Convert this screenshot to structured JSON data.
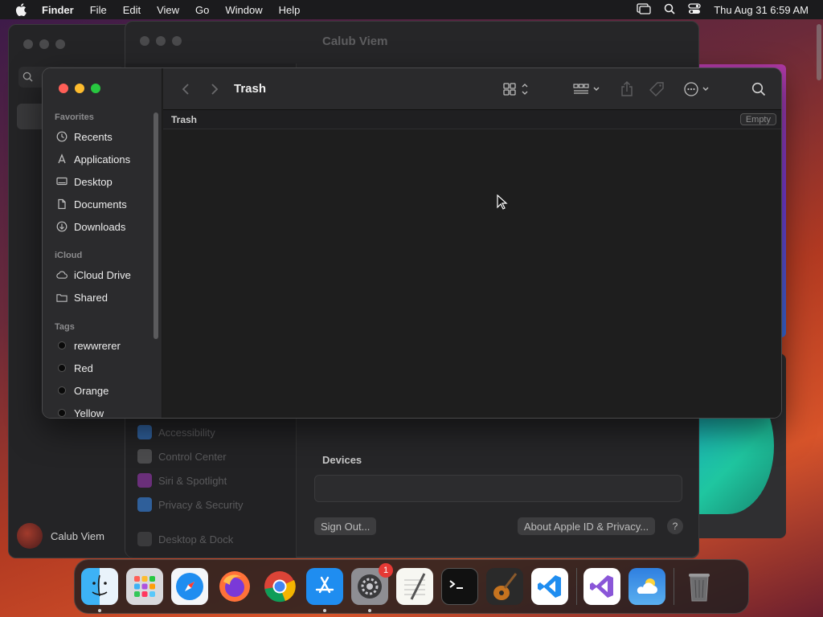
{
  "menubar": {
    "app_name": "Finder",
    "items": [
      "File",
      "Edit",
      "View",
      "Go",
      "Window",
      "Help"
    ],
    "clock": "Thu Aug 31  6:59 AM"
  },
  "background_window": {
    "title": "Calub Viem",
    "user_name": "Calub Viem",
    "sidebar_items": [
      "Accessibility",
      "Control Center",
      "Siri & Spotlight",
      "Privacy & Security",
      "Desktop & Dock"
    ],
    "devices_label": "Devices",
    "sign_out_label": "Sign Out...",
    "about_label": "About Apple ID & Privacy...",
    "help_label": "?"
  },
  "finder": {
    "title": "Trash",
    "path_label": "Trash",
    "empty_label": "Empty",
    "sidebar": {
      "favorites_header": "Favorites",
      "favorites": [
        {
          "label": "Recents",
          "icon": "clock-icon"
        },
        {
          "label": "Applications",
          "icon": "applications-icon"
        },
        {
          "label": "Desktop",
          "icon": "desktop-icon"
        },
        {
          "label": "Documents",
          "icon": "document-icon"
        },
        {
          "label": "Downloads",
          "icon": "download-icon"
        }
      ],
      "icloud_header": "iCloud",
      "icloud": [
        {
          "label": "iCloud Drive",
          "icon": "cloud-icon"
        },
        {
          "label": "Shared",
          "icon": "shared-folder-icon"
        }
      ],
      "tags_header": "Tags",
      "tags": [
        {
          "label": "rewwrerer"
        },
        {
          "label": "Red"
        },
        {
          "label": "Orange"
        },
        {
          "label": "Yellow"
        }
      ]
    }
  },
  "dock": {
    "apps": [
      "Finder",
      "Launchpad",
      "Safari",
      "Firefox",
      "Chrome",
      "App Store",
      "System Settings",
      "TextEdit",
      "Terminal",
      "GarageBand",
      "VS Code",
      "Visual Studio",
      "Weather",
      "Trash"
    ],
    "settings_badge": "1"
  },
  "colors": {
    "red": "#ff5f57",
    "yellow": "#febc2e",
    "green": "#28c840"
  }
}
